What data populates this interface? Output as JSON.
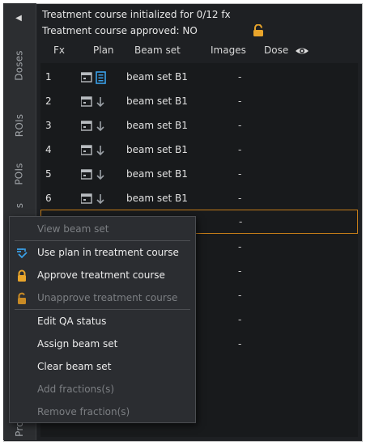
{
  "sidebar": {
    "tabs": [
      {
        "label": "Doses"
      },
      {
        "label": "ROIs"
      },
      {
        "label": "POIs"
      },
      {
        "label": "s"
      },
      {
        "label": "Pro"
      }
    ]
  },
  "header": {
    "line1": "Treatment course initialized for 0/12 fx",
    "line2": "Treatment course approved: NO"
  },
  "columns": {
    "fx": "Fx",
    "plan": "Plan",
    "beam_set": "Beam set",
    "images": "Images",
    "dose": "Dose"
  },
  "rows": [
    {
      "fx": "1",
      "beam_set": "beam set B1",
      "images": "-"
    },
    {
      "fx": "2",
      "beam_set": "beam set B1",
      "images": "-"
    },
    {
      "fx": "3",
      "beam_set": "beam set B1",
      "images": "-"
    },
    {
      "fx": "4",
      "beam_set": "beam set B1",
      "images": "-"
    },
    {
      "fx": "5",
      "beam_set": "beam set B1",
      "images": "-"
    },
    {
      "fx": "6",
      "beam_set": "beam set B1",
      "images": "-"
    },
    {
      "fx": "",
      "beam_set": "",
      "images": "-"
    },
    {
      "fx": "",
      "beam_set": "",
      "images": "-"
    },
    {
      "fx": "",
      "beam_set": "",
      "images": "-"
    },
    {
      "fx": "",
      "beam_set": "",
      "images": "-"
    },
    {
      "fx": "",
      "beam_set": "",
      "images": "-"
    },
    {
      "fx": "",
      "beam_set": "",
      "images": "-"
    }
  ],
  "context_menu": {
    "items": [
      {
        "label": "View beam set",
        "enabled": false,
        "icon": ""
      },
      {
        "label": "Use plan in treatment course",
        "enabled": true,
        "icon": "plan-assign-icon"
      },
      {
        "label": "Approve treatment course",
        "enabled": true,
        "icon": "lock-icon"
      },
      {
        "label": "Unapprove treatment course",
        "enabled": false,
        "icon": "unlock-icon"
      },
      {
        "label": "Edit QA status",
        "enabled": true,
        "icon": ""
      },
      {
        "label": "Assign beam set",
        "enabled": true,
        "icon": ""
      },
      {
        "label": "Clear beam set",
        "enabled": true,
        "icon": ""
      },
      {
        "label": "Add fractions(s)",
        "enabled": false,
        "icon": ""
      },
      {
        "label": "Remove fraction(s)",
        "enabled": false,
        "icon": ""
      }
    ]
  },
  "colors": {
    "accent_blue": "#3aa0e8",
    "lock_gold": "#e9a52b",
    "selection_orange": "#c47c18"
  }
}
